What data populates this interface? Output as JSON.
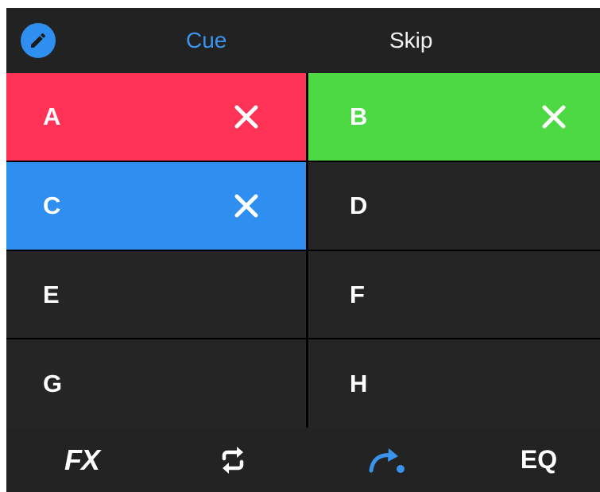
{
  "top_bar": {
    "edit_icon": "pencil-icon",
    "tabs": [
      {
        "label": "Cue",
        "active": true,
        "color": "#3a94ee"
      },
      {
        "label": "Skip",
        "active": false,
        "color": "#f2f2f2"
      }
    ]
  },
  "pads": [
    {
      "label": "A",
      "color": "#ff3356",
      "assigned": true
    },
    {
      "label": "B",
      "color": "#4cd944",
      "assigned": true
    },
    {
      "label": "C",
      "color": "#2f8ff0",
      "assigned": true
    },
    {
      "label": "D",
      "color": "#262525",
      "assigned": false
    },
    {
      "label": "E",
      "color": "#262525",
      "assigned": false
    },
    {
      "label": "F",
      "color": "#262525",
      "assigned": false
    },
    {
      "label": "G",
      "color": "#262525",
      "assigned": false
    },
    {
      "label": "H",
      "color": "#262525",
      "assigned": false
    }
  ],
  "bottom_bar": {
    "fx_label": "FX",
    "loop_icon": "loop-icon",
    "skip_icon": "skip-forward-icon",
    "eq_label": "EQ"
  },
  "colors": {
    "accent": "#3a94ee",
    "background": "#242323"
  }
}
